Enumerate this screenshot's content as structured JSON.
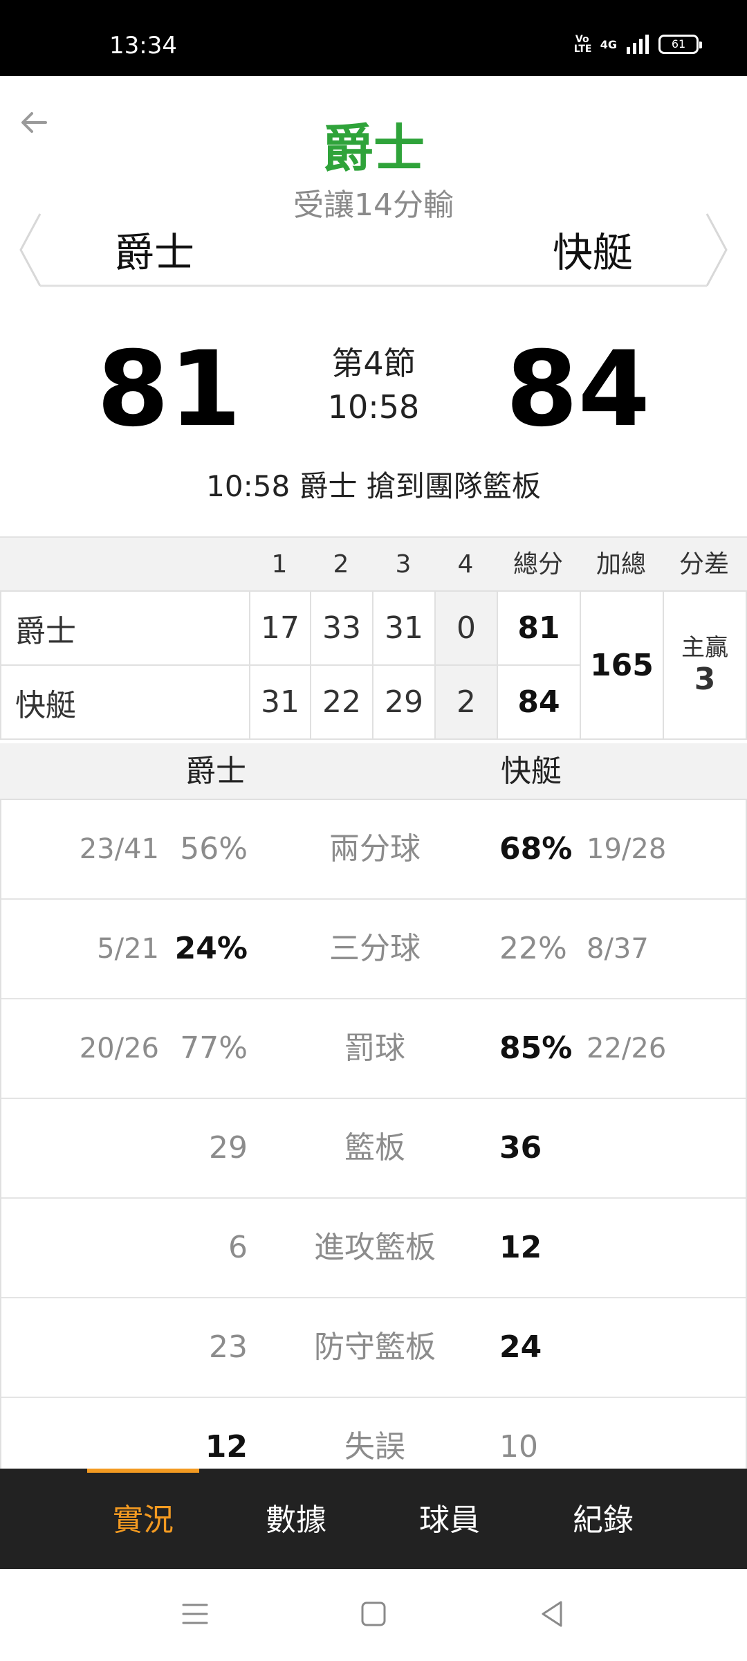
{
  "status": {
    "time": "13:34",
    "volte": "Vo\nLTE",
    "network": "4G",
    "battery": "61"
  },
  "header": {
    "title": "爵士",
    "subtitle": "受讓14分輸",
    "team_left": "爵士",
    "team_right": "快艇"
  },
  "score": {
    "left": "81",
    "right": "84",
    "period": "第4節",
    "clock": "10:58",
    "last_event": "10:58 爵士  搶到團隊籃板"
  },
  "quarters": {
    "headers": [
      "1",
      "2",
      "3",
      "4",
      "總分",
      "加總",
      "分差"
    ],
    "rows": [
      {
        "team": "爵士",
        "q": [
          "17",
          "33",
          "31",
          "0"
        ],
        "total": "81"
      },
      {
        "team": "快艇",
        "q": [
          "31",
          "22",
          "29",
          "2"
        ],
        "total": "84"
      }
    ],
    "sum": "165",
    "diff_label": "主贏",
    "diff_value": "3"
  },
  "stats": {
    "left_team": "爵士",
    "right_team": "快艇",
    "rows": [
      {
        "label": "兩分球",
        "left_frac": "23/41",
        "left": "56%",
        "right": "68%",
        "right_frac": "19/28"
      },
      {
        "label": "三分球",
        "left_frac": "5/21",
        "left": "24%",
        "right": "22%",
        "right_frac": "8/37"
      },
      {
        "label": "罰球",
        "left_frac": "20/26",
        "left": "77%",
        "right": "85%",
        "right_frac": "22/26"
      },
      {
        "label": "籃板",
        "left_frac": "",
        "left": "29",
        "right": "36",
        "right_frac": ""
      },
      {
        "label": "進攻籃板",
        "left_frac": "",
        "left": "6",
        "right": "12",
        "right_frac": ""
      },
      {
        "label": "防守籃板",
        "left_frac": "",
        "left": "23",
        "right": "24",
        "right_frac": ""
      },
      {
        "label": "失誤",
        "left_frac": "",
        "left": "12",
        "right": "10",
        "right_frac": ""
      }
    ]
  },
  "tabs": [
    "實況",
    "數據",
    "球員",
    "紀錄"
  ],
  "active_tab": "實況",
  "colors": {
    "accent": "#f39a21",
    "title_green": "#2fa33a",
    "tabbar": "#222222"
  }
}
